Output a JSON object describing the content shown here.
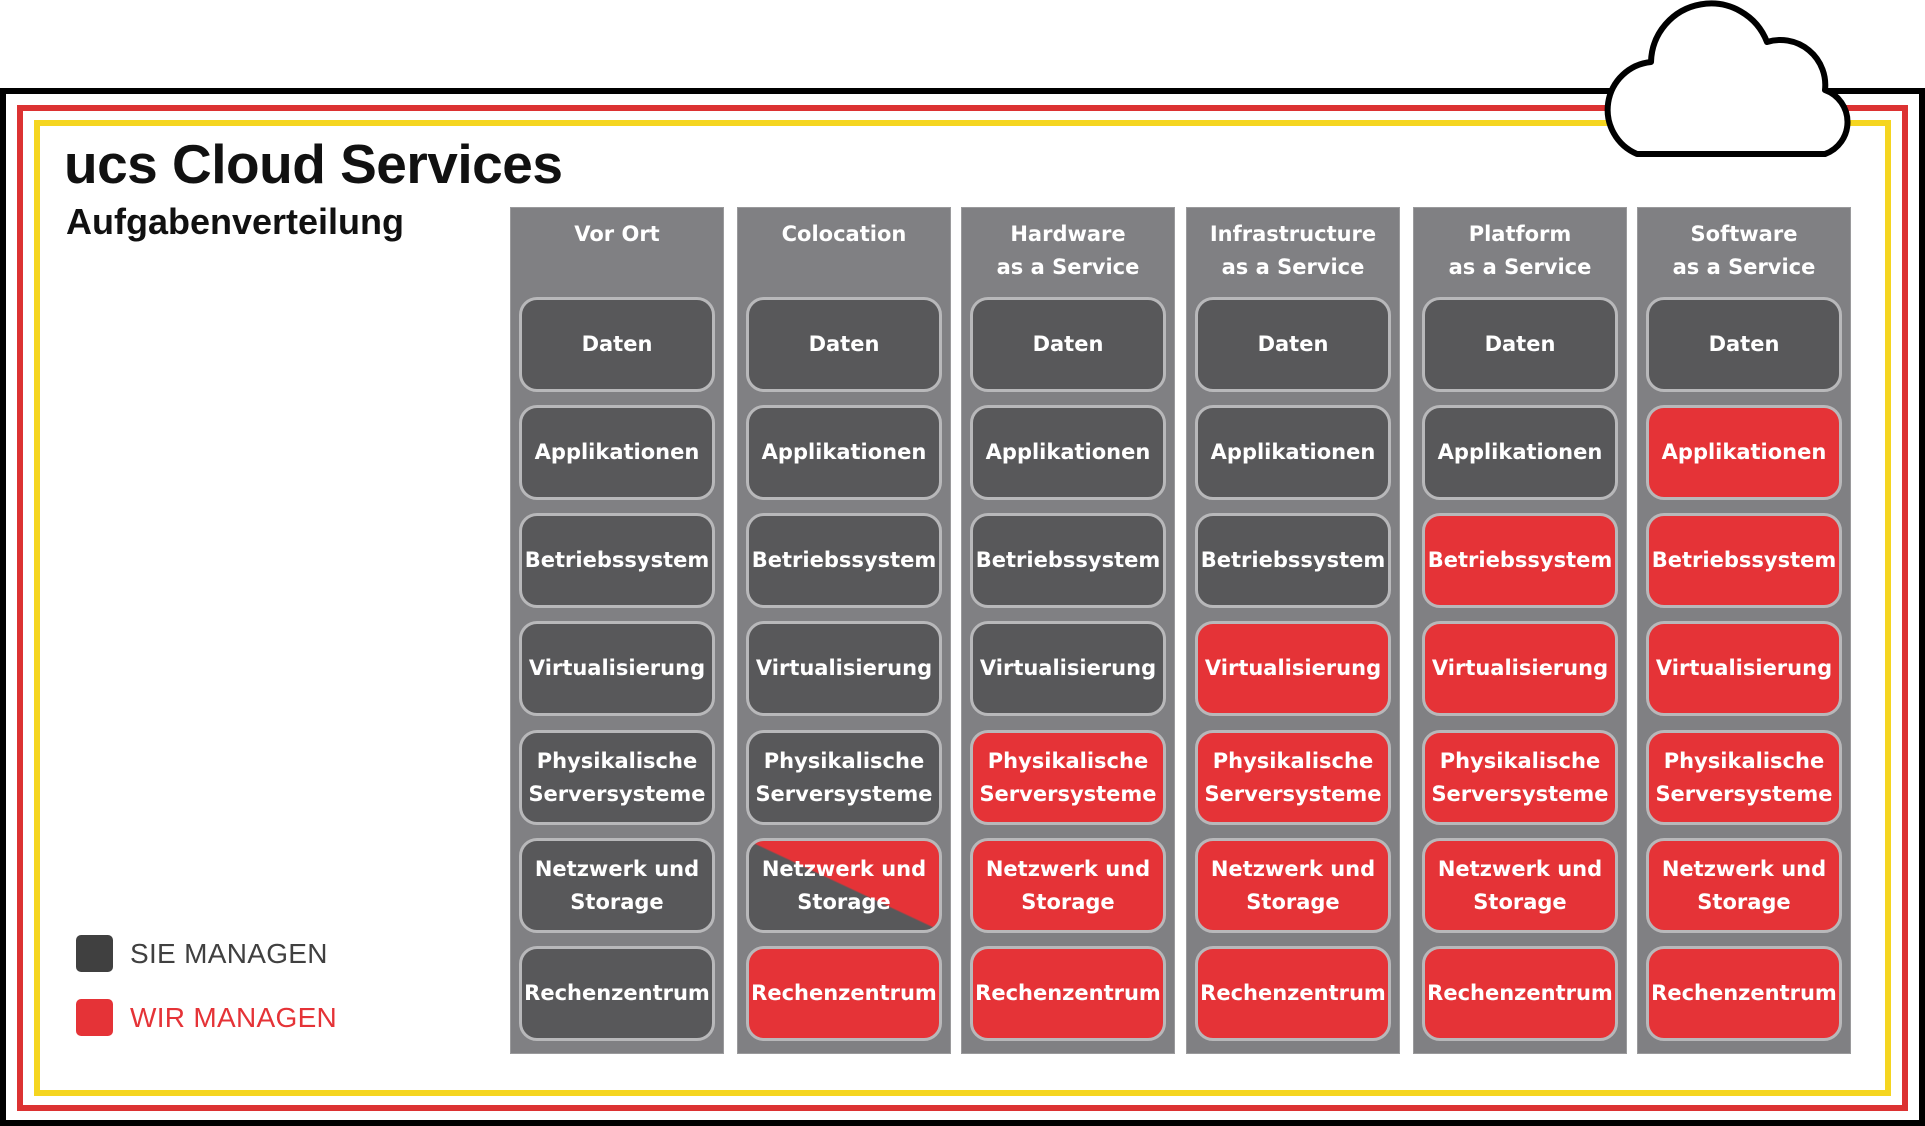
{
  "title": "ucs Cloud Services",
  "subtitle": "Aufgabenverteilung",
  "colors": {
    "sie": "#58585a",
    "wir": "#e53337",
    "legend_sie": "#404040",
    "column_bg": "#808083",
    "frame_black": "#000000",
    "frame_red": "#dc3232",
    "frame_yellow": "#f5d520"
  },
  "legend": [
    {
      "key": "sie",
      "label": "SIE MANAGEN"
    },
    {
      "key": "wir",
      "label": "WIR MANAGEN"
    }
  ],
  "layers": [
    "Daten",
    "Applikationen",
    "Betriebssystem",
    "Virtualisierung",
    "Physikalische\nServersysteme",
    "Netzwerk und\nStorage",
    "Rechenzentrum"
  ],
  "columns": [
    {
      "header": "Vor Ort",
      "managed": [
        "sie",
        "sie",
        "sie",
        "sie",
        "sie",
        "sie",
        "sie"
      ]
    },
    {
      "header": "Colocation",
      "managed": [
        "sie",
        "sie",
        "sie",
        "sie",
        "sie",
        "split",
        "wir"
      ]
    },
    {
      "header": "Hardware\nas a Service",
      "managed": [
        "sie",
        "sie",
        "sie",
        "sie",
        "wir",
        "wir",
        "wir"
      ]
    },
    {
      "header": "Infrastructure\nas a Service",
      "managed": [
        "sie",
        "sie",
        "sie",
        "wir",
        "wir",
        "wir",
        "wir"
      ]
    },
    {
      "header": "Platform\nas a Service",
      "managed": [
        "sie",
        "sie",
        "wir",
        "wir",
        "wir",
        "wir",
        "wir"
      ]
    },
    {
      "header": "Software\nas a Service",
      "managed": [
        "sie",
        "wir",
        "wir",
        "wir",
        "wir",
        "wir",
        "wir"
      ]
    }
  ],
  "icons": {
    "cloud": "cloud-icon"
  }
}
